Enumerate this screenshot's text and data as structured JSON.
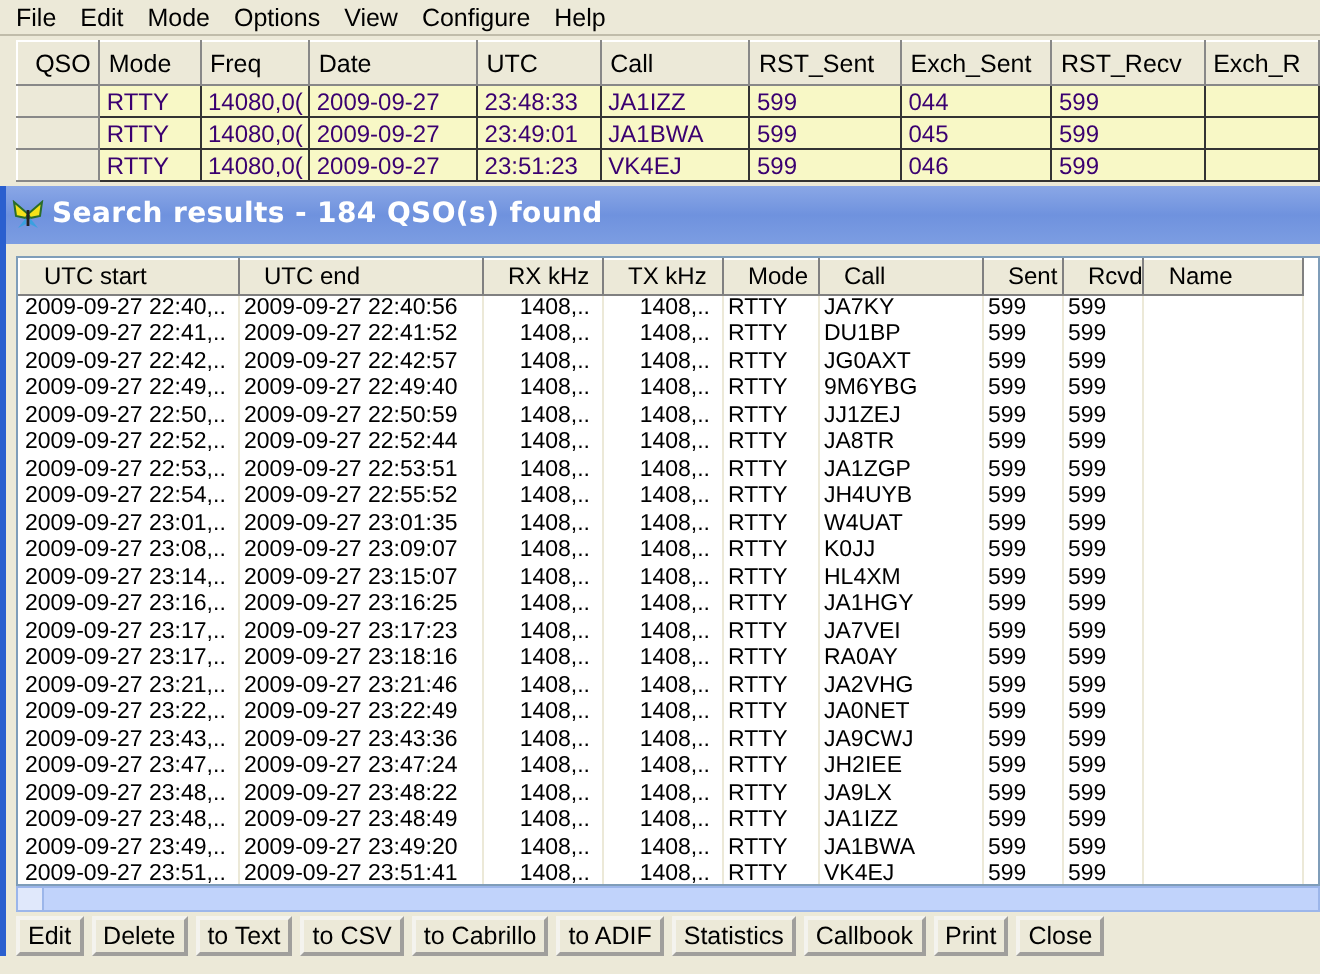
{
  "menu": [
    "File",
    "Edit",
    "Mode",
    "Options",
    "View",
    "Configure",
    "Help"
  ],
  "log_grid": {
    "columns": [
      "QSO",
      "Mode",
      "Freq",
      "Date",
      "UTC",
      "Call",
      "RST_Sent",
      "Exch_Sent",
      "RST_Recv",
      "Exch_R"
    ],
    "rows": [
      [
        "",
        "RTTY",
        "14080,0(",
        "2009-09-27",
        "23:48:33",
        "JA1IZZ",
        "599",
        "044",
        "599",
        ""
      ],
      [
        "",
        "RTTY",
        "14080,0(",
        "2009-09-27",
        "23:49:01",
        "JA1BWA",
        "599",
        "045",
        "599",
        ""
      ],
      [
        "",
        "RTTY",
        "14080,0(",
        "2009-09-27",
        "23:51:23",
        "VK4EJ",
        "599",
        "046",
        "599",
        ""
      ]
    ]
  },
  "search_window": {
    "title": "Search results - 184 QSO(s) found",
    "columns": [
      "UTC start",
      "UTC end",
      "RX kHz",
      "TX kHz",
      "Mode",
      "Call",
      "Sent",
      "Rcvd",
      "Name"
    ],
    "rows": [
      [
        "2009-09-27 22:40,..",
        "2009-09-27 22:40:56",
        "1408,..",
        "1408,..",
        "RTTY",
        "JA7KY",
        "599",
        "599",
        ""
      ],
      [
        "2009-09-27 22:41,..",
        "2009-09-27 22:41:52",
        "1408,..",
        "1408,..",
        "RTTY",
        "DU1BP",
        "599",
        "599",
        ""
      ],
      [
        "2009-09-27 22:42,..",
        "2009-09-27 22:42:57",
        "1408,..",
        "1408,..",
        "RTTY",
        "JG0AXT",
        "599",
        "599",
        ""
      ],
      [
        "2009-09-27 22:49,..",
        "2009-09-27 22:49:40",
        "1408,..",
        "1408,..",
        "RTTY",
        "9M6YBG",
        "599",
        "599",
        ""
      ],
      [
        "2009-09-27 22:50,..",
        "2009-09-27 22:50:59",
        "1408,..",
        "1408,..",
        "RTTY",
        "JJ1ZEJ",
        "599",
        "599",
        ""
      ],
      [
        "2009-09-27 22:52,..",
        "2009-09-27 22:52:44",
        "1408,..",
        "1408,..",
        "RTTY",
        "JA8TR",
        "599",
        "599",
        ""
      ],
      [
        "2009-09-27 22:53,..",
        "2009-09-27 22:53:51",
        "1408,..",
        "1408,..",
        "RTTY",
        "JA1ZGP",
        "599",
        "599",
        ""
      ],
      [
        "2009-09-27 22:54,..",
        "2009-09-27 22:55:52",
        "1408,..",
        "1408,..",
        "RTTY",
        "JH4UYB",
        "599",
        "599",
        ""
      ],
      [
        "2009-09-27 23:01,..",
        "2009-09-27 23:01:35",
        "1408,..",
        "1408,..",
        "RTTY",
        "W4UAT",
        "599",
        "599",
        ""
      ],
      [
        "2009-09-27 23:08,..",
        "2009-09-27 23:09:07",
        "1408,..",
        "1408,..",
        "RTTY",
        "K0JJ",
        "599",
        "599",
        ""
      ],
      [
        "2009-09-27 23:14,..",
        "2009-09-27 23:15:07",
        "1408,..",
        "1408,..",
        "RTTY",
        "HL4XM",
        "599",
        "599",
        ""
      ],
      [
        "2009-09-27 23:16,..",
        "2009-09-27 23:16:25",
        "1408,..",
        "1408,..",
        "RTTY",
        "JA1HGY",
        "599",
        "599",
        ""
      ],
      [
        "2009-09-27 23:17,..",
        "2009-09-27 23:17:23",
        "1408,..",
        "1408,..",
        "RTTY",
        "JA7VEI",
        "599",
        "599",
        ""
      ],
      [
        "2009-09-27 23:17,..",
        "2009-09-27 23:18:16",
        "1408,..",
        "1408,..",
        "RTTY",
        "RA0AY",
        "599",
        "599",
        ""
      ],
      [
        "2009-09-27 23:21,..",
        "2009-09-27 23:21:46",
        "1408,..",
        "1408,..",
        "RTTY",
        "JA2VHG",
        "599",
        "599",
        ""
      ],
      [
        "2009-09-27 23:22,..",
        "2009-09-27 23:22:49",
        "1408,..",
        "1408,..",
        "RTTY",
        "JA0NET",
        "599",
        "599",
        ""
      ],
      [
        "2009-09-27 23:43,..",
        "2009-09-27 23:43:36",
        "1408,..",
        "1408,..",
        "RTTY",
        "JA9CWJ",
        "599",
        "599",
        ""
      ],
      [
        "2009-09-27 23:47,..",
        "2009-09-27 23:47:24",
        "1408,..",
        "1408,..",
        "RTTY",
        "JH2IEE",
        "599",
        "599",
        ""
      ],
      [
        "2009-09-27 23:48,..",
        "2009-09-27 23:48:22",
        "1408,..",
        "1408,..",
        "RTTY",
        "JA9LX",
        "599",
        "599",
        ""
      ],
      [
        "2009-09-27 23:48,..",
        "2009-09-27 23:48:49",
        "1408,..",
        "1408,..",
        "RTTY",
        "JA1IZZ",
        "599",
        "599",
        ""
      ],
      [
        "2009-09-27 23:49,..",
        "2009-09-27 23:49:20",
        "1408,..",
        "1408,..",
        "RTTY",
        "JA1BWA",
        "599",
        "599",
        ""
      ],
      [
        "2009-09-27 23:51,..",
        "2009-09-27 23:51:41",
        "1408,..",
        "1408,..",
        "RTTY",
        "VK4EJ",
        "599",
        "599",
        ""
      ]
    ],
    "buttons": [
      "Edit",
      "Delete",
      "to Text",
      "to CSV",
      "to Cabrillo",
      "to ADIF",
      "Statistics",
      "Callbook",
      "Print",
      "Close"
    ]
  }
}
